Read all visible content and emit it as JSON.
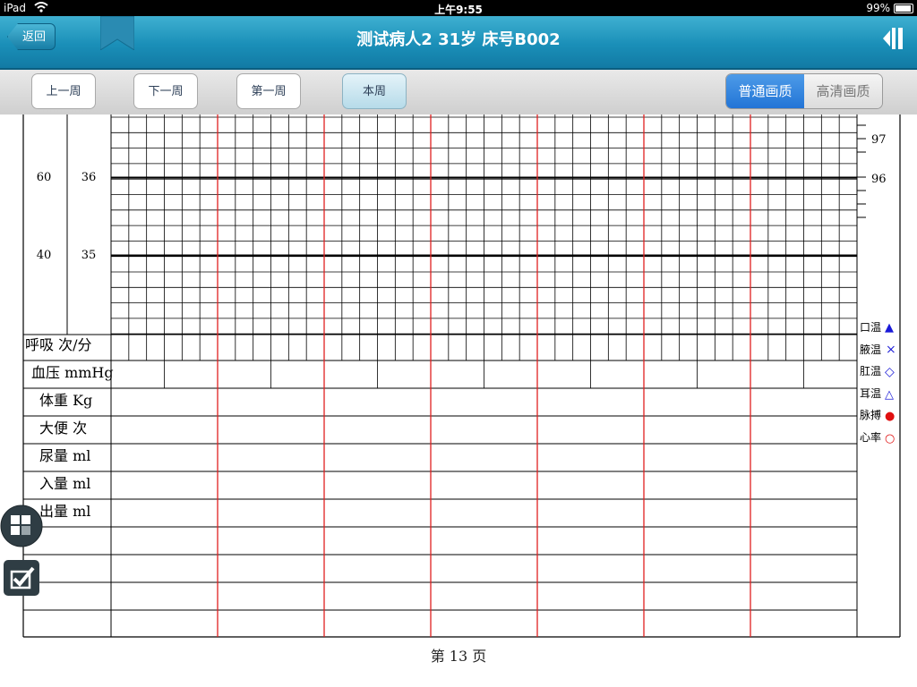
{
  "status_bar": {
    "carrier": "iPad",
    "time": "上午9:55",
    "battery": "99%"
  },
  "header": {
    "back_label": "返回",
    "title": "测试病人2 31岁 床号B002"
  },
  "toolbar": {
    "week_buttons": [
      "上一周",
      "下一周",
      "第一周",
      "本周"
    ],
    "active_week": "本周",
    "quality": [
      {
        "label": "普通画质",
        "selected": true
      },
      {
        "label": "高清画质",
        "selected": false
      }
    ]
  },
  "chart": {
    "left_scale_a": [
      {
        "value": "60"
      },
      {
        "value": "40"
      }
    ],
    "left_scale_b": [
      {
        "value": "36"
      },
      {
        "value": "35"
      }
    ],
    "right_scale": [
      "97",
      "96"
    ],
    "rows": [
      {
        "label": "呼吸 次/分"
      },
      {
        "label": "血压 mmHg"
      },
      {
        "label": "体重 Kg"
      },
      {
        "label": "大便 次"
      },
      {
        "label": "尿量 ml"
      },
      {
        "label": "入量 ml"
      },
      {
        "label": "出量 ml"
      }
    ],
    "legend": [
      {
        "label": "口温",
        "symbol": "▲",
        "color": "#1a1ad8"
      },
      {
        "label": "腋温",
        "symbol": "×",
        "color": "#1a1ad8"
      },
      {
        "label": "肛温",
        "symbol": "◇",
        "color": "#1a1ad8"
      },
      {
        "label": "耳温",
        "symbol": "△",
        "color": "#1a1ad8"
      },
      {
        "label": "脉搏",
        "symbol": "●",
        "color": "#e01010"
      },
      {
        "label": "心率",
        "symbol": "○",
        "color": "#e01010"
      }
    ],
    "day_line_color": "#e02020"
  },
  "footer": {
    "page": "第 13 页"
  },
  "floating": {
    "layout_icon": "grid-layout-icon",
    "check_icon": "checkbox-edit-icon"
  }
}
